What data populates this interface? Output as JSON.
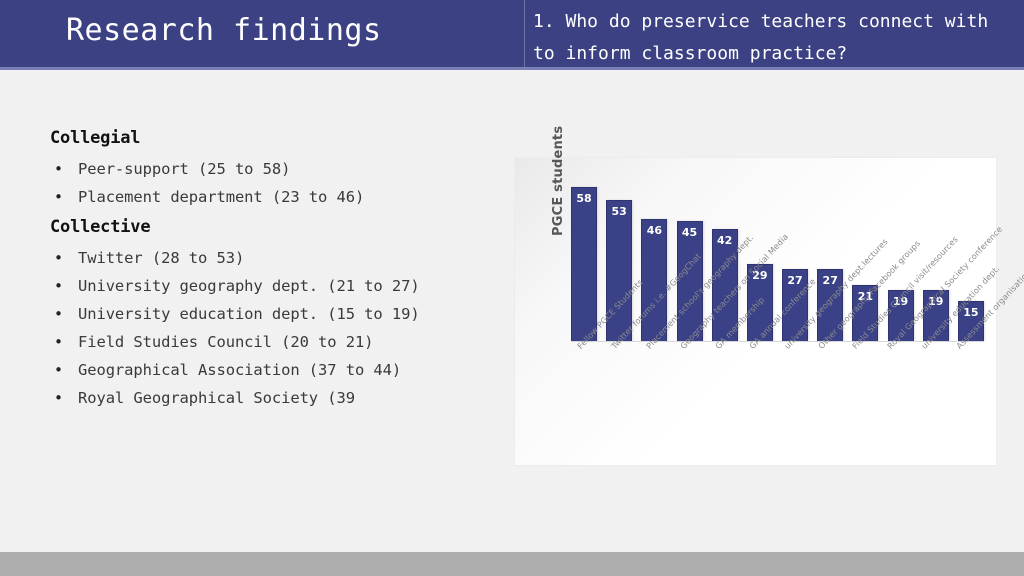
{
  "header": {
    "title": "Research findings",
    "question": "1. Who do preservice teachers connect with to inform classroom practice?",
    "band_color": "#3b4182",
    "underline_color": "#7a7fb4"
  },
  "content": {
    "sections": [
      {
        "heading": "Collegial",
        "bullets": [
          "Peer-support (25 to 58)",
          "Placement department (23 to 46)"
        ]
      },
      {
        "heading": "Collective",
        "bullets": [
          "Twitter (28 to 53)",
          "University geography dept. (21 to 27)",
          "University education dept. (15 to 19)",
          "Field Studies Council (20 to 21)",
          "Geographical Association (37 to 44)",
          "Royal Geographical Society (39"
        ]
      }
    ],
    "bullet_glyph": "•"
  },
  "chart_data": {
    "type": "bar",
    "title": "",
    "xlabel": "",
    "ylabel": "PGCE students",
    "ylim": [
      0,
      62
    ],
    "grid": false,
    "legend": "none",
    "bar_color": "#3b4186",
    "label_color": "#ffffff",
    "categories": [
      "Fellow PGCE Students",
      "Twitter forums i.e. #GeogChat",
      "Placement school's geography dept.",
      "Geography teachers on Social Media",
      "GA membership",
      "GA annual conference",
      "university geography dept.lectures",
      "Other geography Facebook groups",
      "Field Studies Council visit/resources",
      "Royal Geographical Society conference",
      "university education dept.",
      "Assessment organisation FB groups"
    ],
    "values": [
      58,
      53,
      46,
      45,
      42,
      29,
      27,
      27,
      21,
      19,
      19,
      15
    ]
  },
  "footer": {
    "bar_color": "#aeaeae"
  }
}
